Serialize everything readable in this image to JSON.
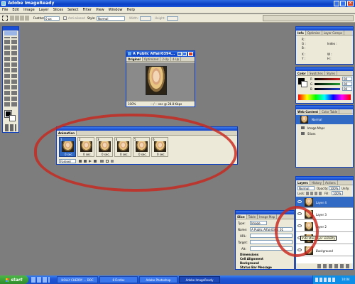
{
  "app": {
    "title": "Adobe ImageReady"
  },
  "menu": [
    "File",
    "Edit",
    "Image",
    "Layer",
    "Slices",
    "Select",
    "Filter",
    "View",
    "Window",
    "Help"
  ],
  "options": {
    "feather_label": "Feather:",
    "feather_value": "0 px",
    "anti_aliased": "Anti-aliased",
    "style_label": "Style:",
    "style_value": "Normal",
    "width_label": "Width:",
    "height_label": "Height:"
  },
  "document": {
    "title": "A Public Affair0394...",
    "tabs": [
      "Original",
      "Optimized",
      "2-Up",
      "4-Up"
    ],
    "zoom": "100%",
    "status": "-- / -- sec @ 28.8 Kbps"
  },
  "animation": {
    "tab": "Animation",
    "frames": [
      {
        "num": "1",
        "delay": "0 sec."
      },
      {
        "num": "2",
        "delay": "0 sec."
      },
      {
        "num": "3",
        "delay": "0 sec."
      },
      {
        "num": "4",
        "delay": "0 sec."
      },
      {
        "num": "5",
        "delay": "0 sec."
      },
      {
        "num": "6",
        "delay": "0 sec."
      }
    ],
    "loop": "Forever"
  },
  "info": {
    "tabs": [
      "Info",
      "Optimize",
      "Layer Comps"
    ],
    "labels": [
      "R :",
      "G :",
      "B :",
      "Index :",
      "X :",
      "Y :",
      "W :",
      "H :"
    ]
  },
  "color": {
    "tabs": [
      "Color",
      "Swatches",
      "Styles"
    ],
    "rows": [
      {
        "label": "R",
        "value": "00"
      },
      {
        "label": "G",
        "value": "00"
      },
      {
        "label": "B",
        "value": "00"
      }
    ],
    "colors": {
      "r": "#d42020",
      "g": "#20a030",
      "b": "#2040d0"
    }
  },
  "webcontent": {
    "tabs": [
      "Web Content",
      "Color Table"
    ],
    "items": [
      "Normal",
      "Image Maps",
      "Slices"
    ]
  },
  "layers": {
    "tabs": [
      "Layers",
      "History",
      "Actions"
    ],
    "blend": "Normal",
    "opacity_label": "Opacity:",
    "opacity_value": "100%",
    "unify_label": "Unify:",
    "lock_label": "Lock:",
    "fill_label": "Fill:",
    "fill_value": "100%",
    "items": [
      "Layer 4",
      "Layer 3",
      "Layer 2",
      "Layer 1",
      "Background"
    ],
    "tooltip": "Indicates layer visibility"
  },
  "slice": {
    "tabs": [
      "Slice",
      "Table",
      "Image Map"
    ],
    "type_label": "Type:",
    "type_value": "Image",
    "name_label": "Name:",
    "name_value": "A Public Affair0394_01",
    "url_label": "URL:",
    "target_label": "Target:",
    "alt_label": "Alt:",
    "sections": [
      "Dimensions",
      "Cell Alignment",
      "Background",
      "Status Bar Message"
    ]
  },
  "taskbar": {
    "start": "start",
    "items": [
      {
        "label": "HOLLY CHERRY ... DOC"
      },
      {
        "label": "8 Firefox"
      },
      {
        "label": "Adobe Photoshop"
      },
      {
        "label": "Adobe ImageReady"
      }
    ],
    "clock": "10:04"
  }
}
